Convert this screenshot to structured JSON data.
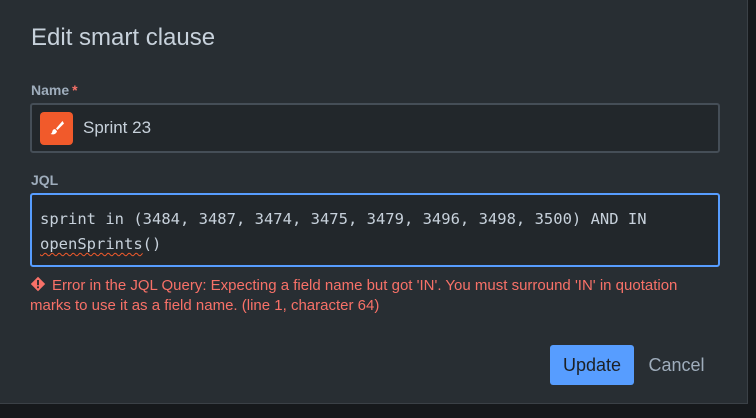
{
  "dialog": {
    "title": "Edit smart clause"
  },
  "name_field": {
    "label": "Name",
    "required_marker": "*",
    "value": "Sprint 23",
    "icon": "paintbrush-icon",
    "icon_color": "#f15a2b"
  },
  "jql_field": {
    "label": "JQL",
    "value_main": "sprint in (3484, 3487, 3474, 3475, 3479, 3496, 3498, 3500) AND IN ",
    "value_flagged": "openSprints",
    "value_tail": "()"
  },
  "error": {
    "icon": "error-icon",
    "message": "Error in the JQL Query: Expecting a field name but got 'IN'. You must surround 'IN' in quotation marks to use it as a field name. (line 1, character 64)",
    "color": "#f87168"
  },
  "actions": {
    "update_label": "Update",
    "cancel_label": "Cancel",
    "accent": "#579dff"
  }
}
